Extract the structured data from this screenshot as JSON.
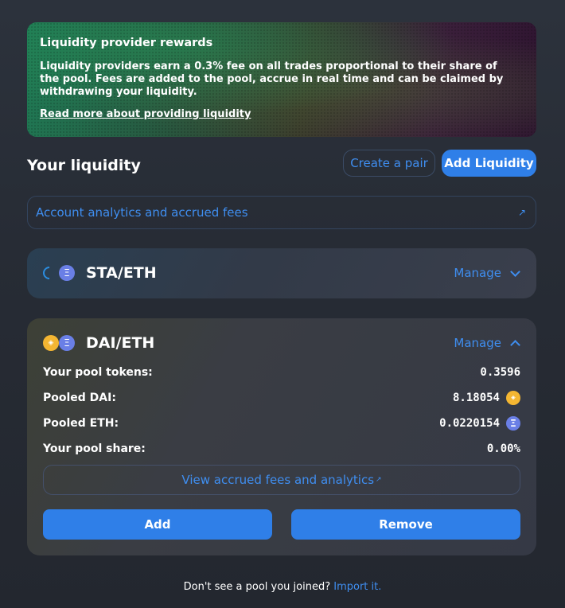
{
  "banner": {
    "title": "Liquidity provider rewards",
    "text": "Liquidity providers earn a 0.3% fee on all trades proportional to their share of the pool. Fees are added to the pool, accrue in real time and can be claimed by withdrawing your liquidity.",
    "link": "Read more about providing liquidity"
  },
  "header": {
    "title": "Your liquidity",
    "create_pair": "Create a pair",
    "add_liquidity": "Add Liquidity"
  },
  "analytics": {
    "label": "Account analytics and accrued fees",
    "arrow": "↗"
  },
  "pools": [
    {
      "pair": "STA/ETH",
      "manage": "Manage",
      "expanded": false
    },
    {
      "pair": "DAI/ETH",
      "manage": "Manage",
      "expanded": true,
      "stats": [
        {
          "label": "Your pool tokens:",
          "value": "0.3596"
        },
        {
          "label": "Pooled DAI:",
          "value": "8.18054"
        },
        {
          "label": "Pooled ETH:",
          "value": "0.0220154"
        },
        {
          "label": "Your pool share:",
          "value": "0.00%"
        }
      ],
      "fees_link": "View accrued fees and analytics",
      "fees_arrow": "↗",
      "add": "Add",
      "remove": "Remove"
    }
  ],
  "footer": {
    "text": "Don't see a pool you joined?",
    "link": "Import it."
  },
  "icons": {
    "eth": "Ξ",
    "dai": "◈"
  },
  "colors": {
    "accent": "#2f7fe8",
    "link": "#3f8ef0",
    "eth": "#6a7fe6",
    "dai": "#f4b632"
  }
}
